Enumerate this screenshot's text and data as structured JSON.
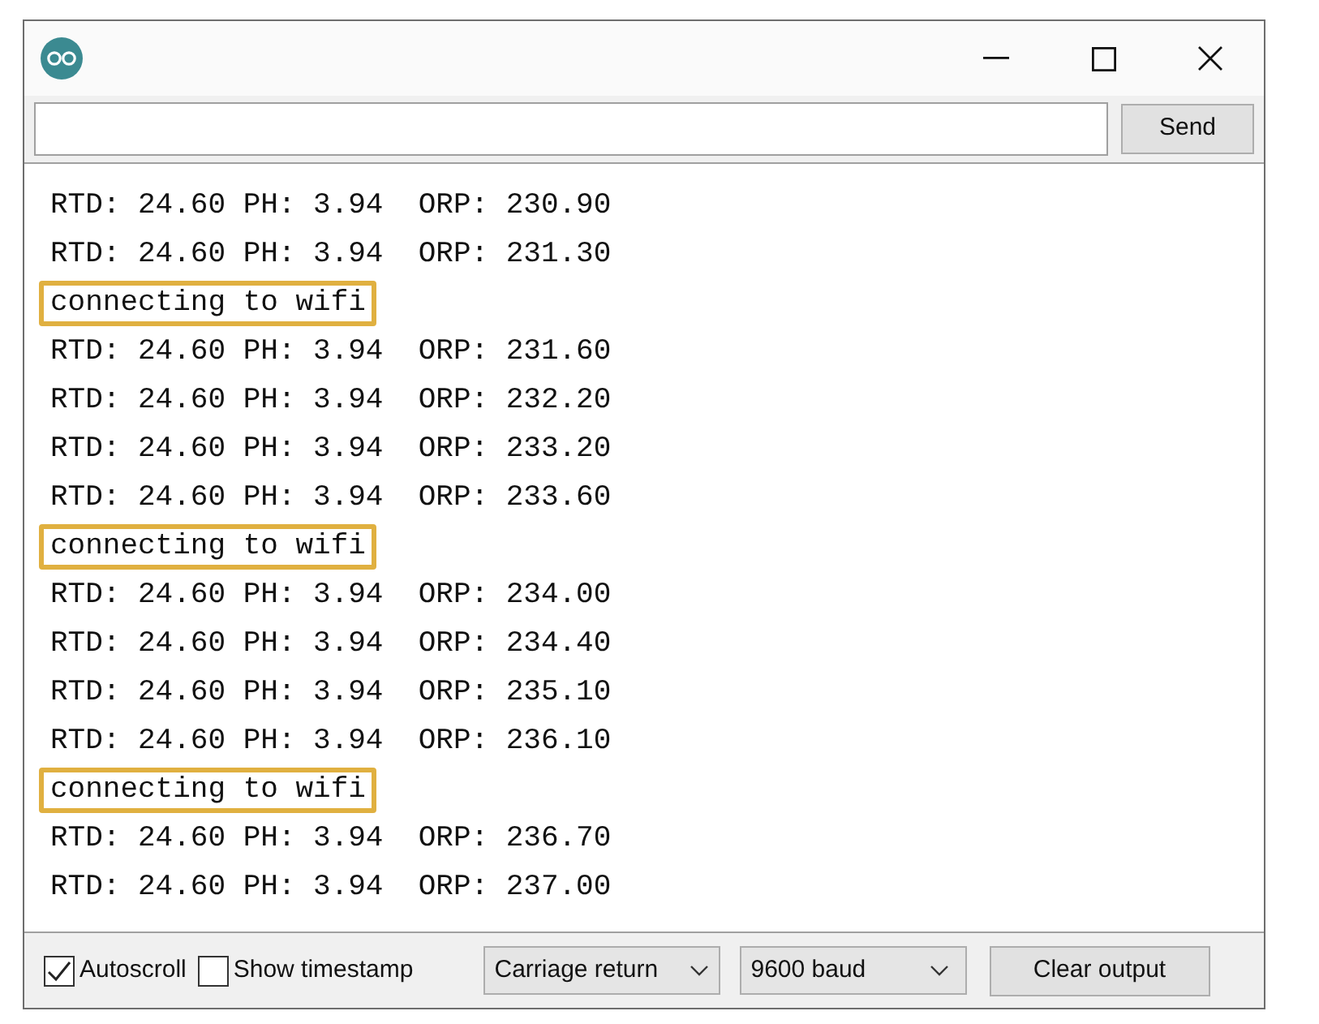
{
  "send_button": "Send",
  "output_lines": [
    {
      "text": "RTD: 24.60 PH: 3.94  ORP: 230.90",
      "highlighted": false
    },
    {
      "text": "RTD: 24.60 PH: 3.94  ORP: 231.30",
      "highlighted": false
    },
    {
      "text": "connecting to wifi",
      "highlighted": true
    },
    {
      "text": "RTD: 24.60 PH: 3.94  ORP: 231.60",
      "highlighted": false
    },
    {
      "text": "RTD: 24.60 PH: 3.94  ORP: 232.20",
      "highlighted": false
    },
    {
      "text": "RTD: 24.60 PH: 3.94  ORP: 233.20",
      "highlighted": false
    },
    {
      "text": "RTD: 24.60 PH: 3.94  ORP: 233.60",
      "highlighted": false
    },
    {
      "text": "connecting to wifi",
      "highlighted": true
    },
    {
      "text": "RTD: 24.60 PH: 3.94  ORP: 234.00",
      "highlighted": false
    },
    {
      "text": "RTD: 24.60 PH: 3.94  ORP: 234.40",
      "highlighted": false
    },
    {
      "text": "RTD: 24.60 PH: 3.94  ORP: 235.10",
      "highlighted": false
    },
    {
      "text": "RTD: 24.60 PH: 3.94  ORP: 236.10",
      "highlighted": false
    },
    {
      "text": "connecting to wifi",
      "highlighted": true
    },
    {
      "text": "RTD: 24.60 PH: 3.94  ORP: 236.70",
      "highlighted": false
    },
    {
      "text": "RTD: 24.60 PH: 3.94  ORP: 237.00",
      "highlighted": false
    }
  ],
  "options": [
    {
      "label": "Autoscroll",
      "checked": true
    },
    {
      "label": "Show timestamp",
      "checked": false
    }
  ],
  "line_ending": "Carriage return",
  "baud_rate": "9600 baud",
  "clear_button": "Clear output"
}
